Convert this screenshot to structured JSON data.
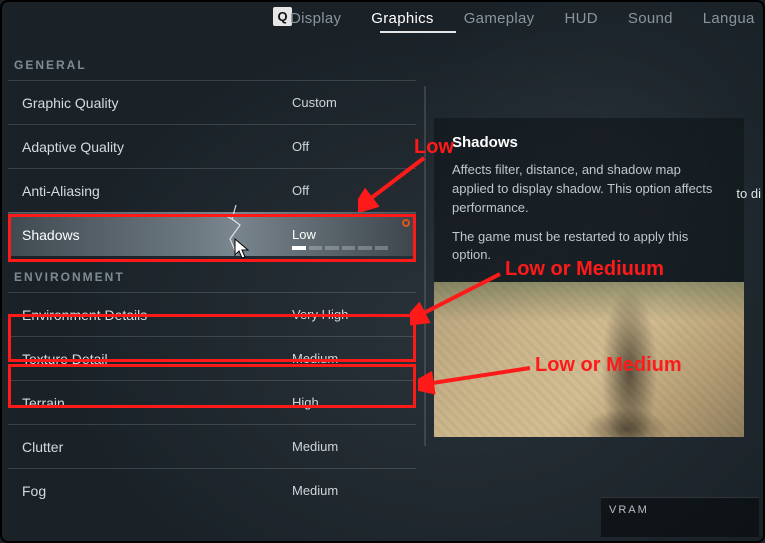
{
  "tabs": {
    "key_hint": "Q",
    "items": [
      "Display",
      "Graphics",
      "Gameplay",
      "HUD",
      "Sound",
      "Langua"
    ],
    "active_index": 1
  },
  "sections": {
    "general": {
      "header": "GENERAL",
      "rows": [
        {
          "label": "Graphic Quality",
          "value": "Custom"
        },
        {
          "label": "Adaptive Quality",
          "value": "Off"
        },
        {
          "label": "Anti-Aliasing",
          "value": "Off"
        },
        {
          "label": "Shadows",
          "value": "Low",
          "selected": true
        }
      ]
    },
    "environment": {
      "header": "ENVIRONMENT",
      "rows": [
        {
          "label": "Environment Details",
          "value": "Very High"
        },
        {
          "label": "Texture Detail",
          "value": "Medium"
        },
        {
          "label": "Terrain",
          "value": "High"
        },
        {
          "label": "Clutter",
          "value": "Medium"
        },
        {
          "label": "Fog",
          "value": "Medium"
        }
      ]
    }
  },
  "info": {
    "title": "Shadows",
    "desc1": "Affects filter, distance, and shadow map applied to display shadow. This option affects performance.",
    "desc2": "The game must be restarted to apply this option."
  },
  "edge_text": "to di",
  "vram_label": "VRAM",
  "annotations": {
    "low": "Low",
    "low_or_mediuum": "Low or Mediuum",
    "low_or_medium": "Low or Medium"
  }
}
